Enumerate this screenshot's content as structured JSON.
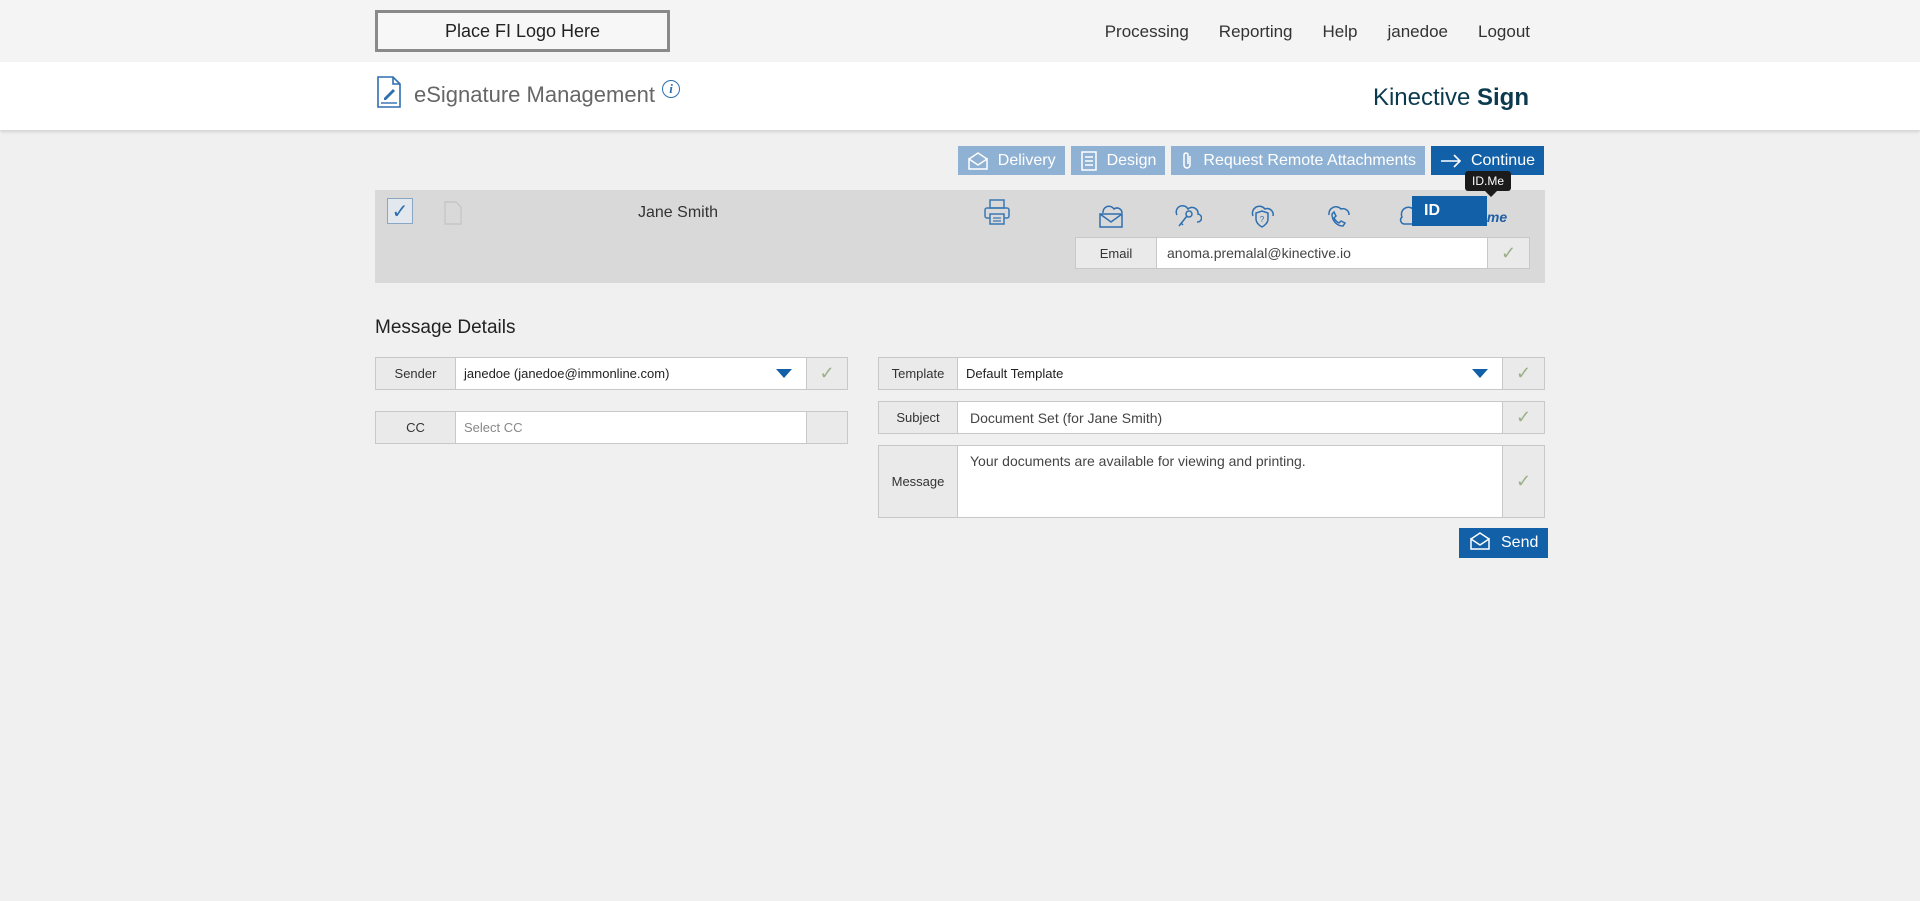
{
  "logo": {
    "placeholder": "Place FI Logo Here"
  },
  "nav": {
    "items": [
      "Processing",
      "Reporting",
      "Help",
      "janedoe",
      "Logout"
    ]
  },
  "header": {
    "title": "eSignature Management",
    "info_icon": "i",
    "brand_light": "Kinective",
    "brand_bold": "Sign"
  },
  "actions": {
    "delivery": "Delivery",
    "design": "Design",
    "attachments": "Request Remote Attachments",
    "continue": "Continue"
  },
  "recipient": {
    "checked": true,
    "name": "Jane Smith",
    "idme_tooltip": "ID.Me",
    "idme_badge": "ID",
    "idme_text": ".me",
    "email_label": "Email",
    "email_value": "anoma.premalal@kinective.io",
    "icons": [
      "printer-icon",
      "cloud-email-icon",
      "cloud-key-icon",
      "cloud-question-icon",
      "cloud-phone-icon",
      "idme-icon"
    ]
  },
  "message": {
    "section_title": "Message Details",
    "sender_label": "Sender",
    "sender_value": "janedoe (janedoe@immonline.com)",
    "cc_label": "CC",
    "cc_placeholder": "Select CC",
    "template_label": "Template",
    "template_value": "Default Template",
    "subject_label": "Subject",
    "subject_value": "Document Set (for Jane Smith)",
    "message_label": "Message",
    "message_value": "Your documents are available for viewing and printing.",
    "send_label": "Send"
  },
  "colors": {
    "primary": "#1260a8",
    "primary_light": "#8fb1d3",
    "brand": "#0b3a4f",
    "check": "#9bb08a"
  }
}
